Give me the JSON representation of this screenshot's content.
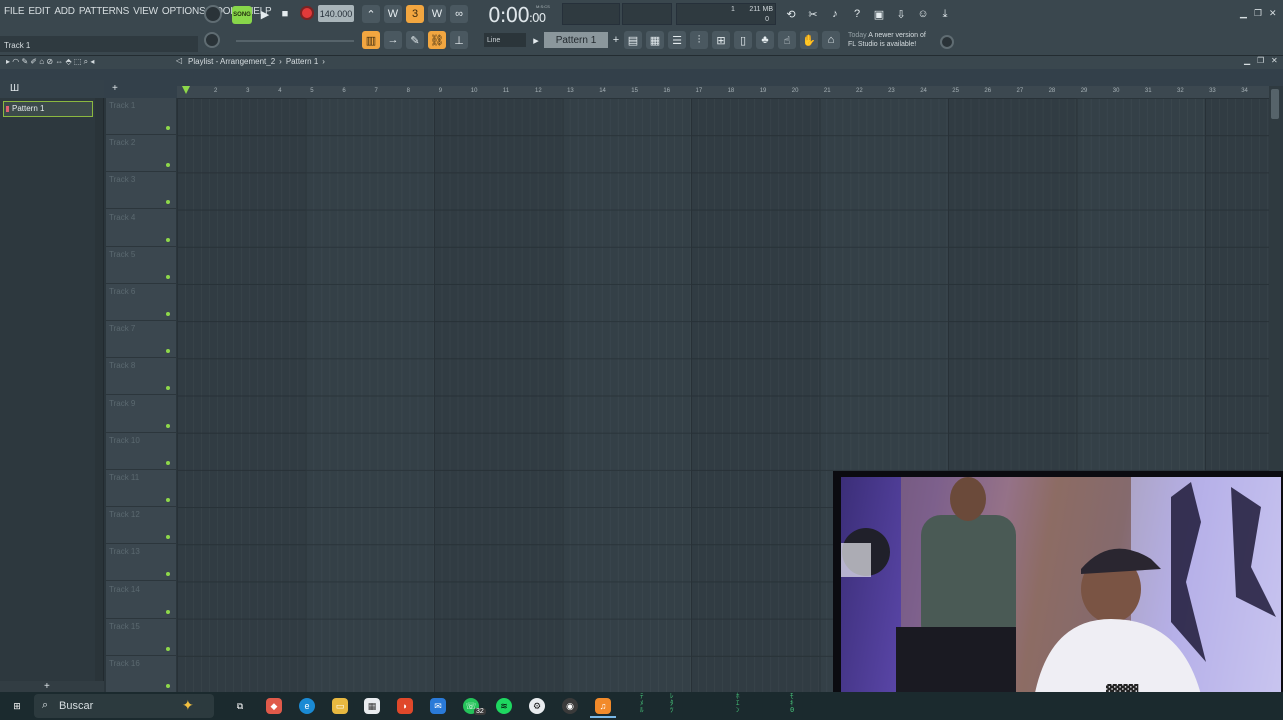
{
  "menu": [
    "FILE",
    "EDIT",
    "ADD",
    "PATTERNS",
    "VIEW",
    "OPTIONS",
    "TOOLS",
    "HELP"
  ],
  "hint_text": "Track 1",
  "transport": {
    "tempo": "140.000",
    "time_main": "0:00",
    "time_sub": ":00",
    "time_unit": "M:S:CS",
    "song_mode_label": "SONG"
  },
  "memory": {
    "cpu": "1",
    "ram": "211 MB",
    "poly": "0"
  },
  "snap": "Line",
  "pattern_selector": "Pattern 1",
  "news": {
    "date": "Today",
    "line1": "A newer version of",
    "line2": "FL Studio is available!"
  },
  "playlist": {
    "breadcrumb": [
      "Playlist - Arrangement_2",
      "Pattern 1"
    ],
    "pattern_item": "Pattern 1",
    "tracks": [
      "Track 1",
      "Track 2",
      "Track 3",
      "Track 4",
      "Track 5",
      "Track 6",
      "Track 7",
      "Track 8",
      "Track 9",
      "Track 10",
      "Track 11",
      "Track 12",
      "Track 13",
      "Track 14",
      "Track 15",
      "Track 16"
    ],
    "bars": [
      "2",
      "3",
      "4",
      "5",
      "6",
      "7",
      "8",
      "9",
      "10",
      "11",
      "12",
      "13",
      "14",
      "15",
      "16",
      "17",
      "18",
      "19",
      "20",
      "21",
      "22",
      "23",
      "24",
      "25",
      "26",
      "27",
      "28",
      "29",
      "30",
      "31",
      "32",
      "33",
      "34"
    ]
  },
  "taskbar": {
    "search_placeholder": "Buscar",
    "badge": "32"
  },
  "colors": {
    "accent_orange": "#f2a640",
    "accent_green": "#88d64a",
    "record_red": "#e23a3a",
    "grid_bg": "#344047"
  }
}
